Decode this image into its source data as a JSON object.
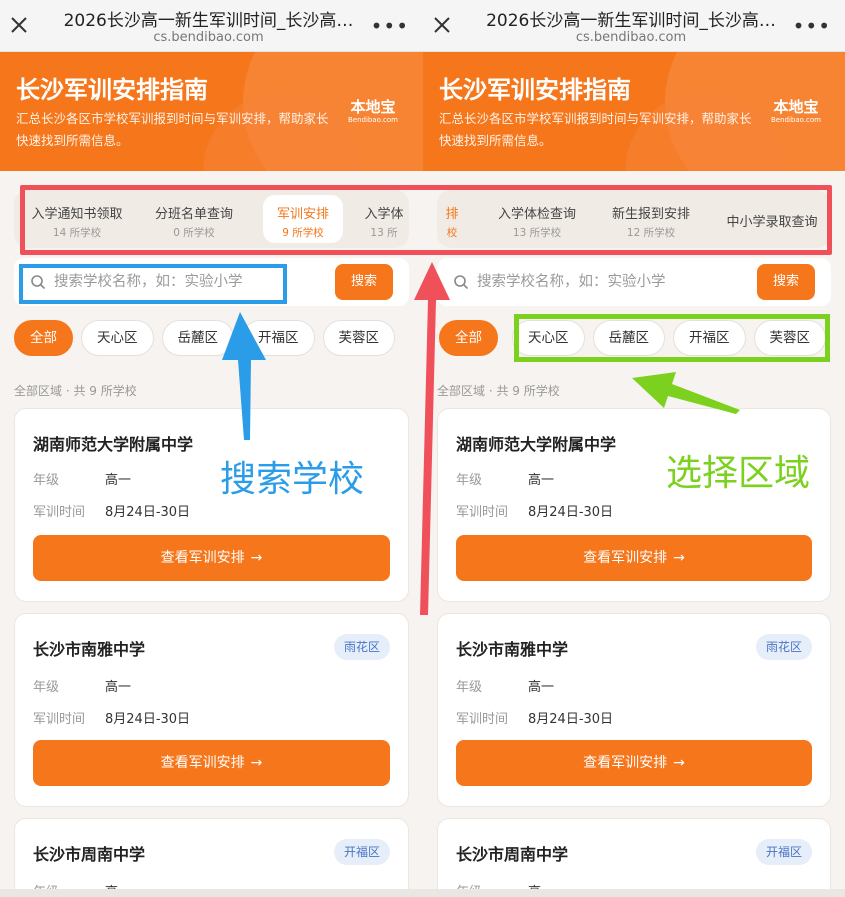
{
  "browser": {
    "title": "2026长沙高一新生军训时间_长沙高…",
    "domain": "cs.bendibao.com",
    "more_label": "•••"
  },
  "banner": {
    "title": "长沙军训安排指南",
    "description": "汇总长沙各区市学校军训报到时间与军训安排，帮助家长快速找到所需信息。",
    "logo_text": "本地宝",
    "logo_sub": "Bendibao.com"
  },
  "left_tabs": [
    {
      "label": "入学通知书领取",
      "count": "14 所学校"
    },
    {
      "label": "分班名单查询",
      "count": "0 所学校"
    },
    {
      "label": "军训安排",
      "count": "9 所学校"
    },
    {
      "label": "入学体",
      "count": "13 所"
    }
  ],
  "right_tabs": [
    {
      "label": "排",
      "count": "校"
    },
    {
      "label": "入学体检查询",
      "count": "13 所学校"
    },
    {
      "label": "新生报到安排",
      "count": "12 所学校"
    },
    {
      "label": "中小学录取查询",
      "count": ""
    }
  ],
  "search": {
    "placeholder": "搜索学校名称，如：实验小学",
    "button_label": "搜索"
  },
  "left_chips": [
    "全部",
    "天心区",
    "岳麓区",
    "开福区",
    "芙蓉区"
  ],
  "right_chips": [
    "全部",
    "天心区",
    "岳麓区",
    "开福区",
    "芙蓉区"
  ],
  "summary": "全部区域 · 共 9 所学校",
  "row_labels": {
    "grade": "年级",
    "time": "军训时间"
  },
  "cta_label": "查看军训安排",
  "cta_arrow": "→",
  "schools": [
    {
      "name": "湖南师范大学附属中学",
      "district": "",
      "grade": "高一",
      "time": "8月24日-30日"
    },
    {
      "name": "长沙市南雅中学",
      "district": "雨花区",
      "grade": "高一",
      "time": "8月24日-30日"
    },
    {
      "name": "长沙市周南中学",
      "district": "开福区",
      "grade": "高一",
      "time": ""
    }
  ],
  "annotations": {
    "search_label": "搜索学校",
    "region_label": "选择区域",
    "colors": {
      "red": "#f0505a",
      "blue": "#2b9de8",
      "green": "#7bd11e"
    }
  },
  "colors": {
    "accent": "#f5761b",
    "badge_bg": "#e6eefa",
    "badge_text": "#4a74c4"
  }
}
